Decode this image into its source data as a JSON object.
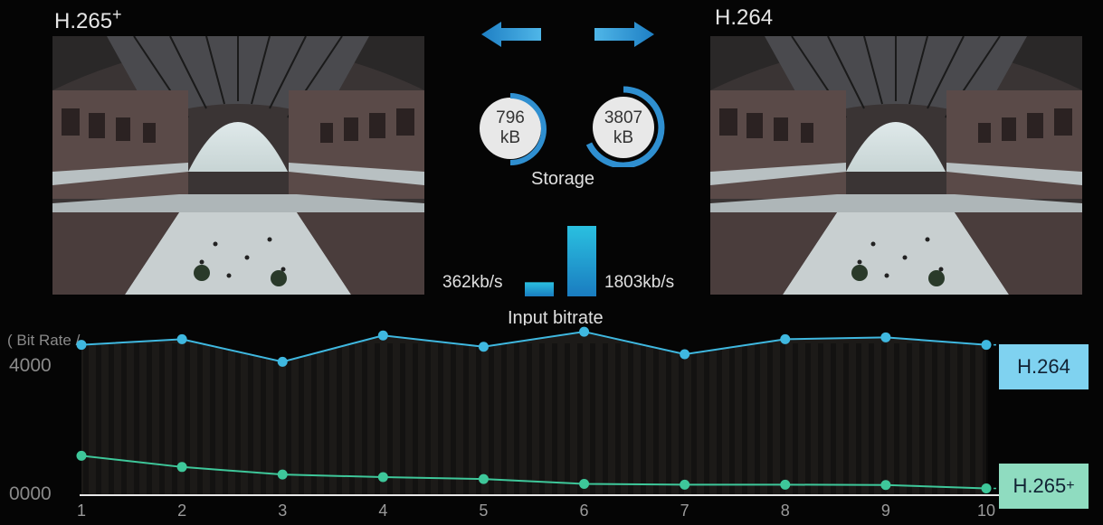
{
  "left_codec": {
    "name": "H.265",
    "sup": "+"
  },
  "right_codec": {
    "name": "H.264"
  },
  "storage": {
    "label": "Storage",
    "h265": {
      "value": "796",
      "unit": "kB"
    },
    "h264": {
      "value": "3807",
      "unit": "kB"
    }
  },
  "bitrate": {
    "label": "Input bitrate",
    "h265": "362kb/s",
    "h264": "1803kb/s",
    "h265_value": 362,
    "h264_value": 1803
  },
  "chart_data": {
    "type": "line",
    "ylabel": "( Bit Rate / kbps )",
    "y_ticks": [
      "4000",
      "0000"
    ],
    "ylim": [
      0,
      4400
    ],
    "x": [
      1,
      2,
      3,
      4,
      5,
      6,
      7,
      8,
      9,
      10
    ],
    "series": [
      {
        "name": "H.264",
        "legend_sup": "",
        "color": "#3fb8e0",
        "tag_color": "#7fd2f0",
        "values": [
          4000,
          4150,
          3550,
          4250,
          3950,
          4350,
          3750,
          4150,
          4200,
          4000
        ]
      },
      {
        "name": "H.265",
        "legend_sup": "+",
        "color": "#3ec79a",
        "tag_color": "#8fdcc0",
        "values": [
          1050,
          750,
          550,
          480,
          430,
          300,
          280,
          280,
          270,
          180
        ]
      }
    ]
  }
}
